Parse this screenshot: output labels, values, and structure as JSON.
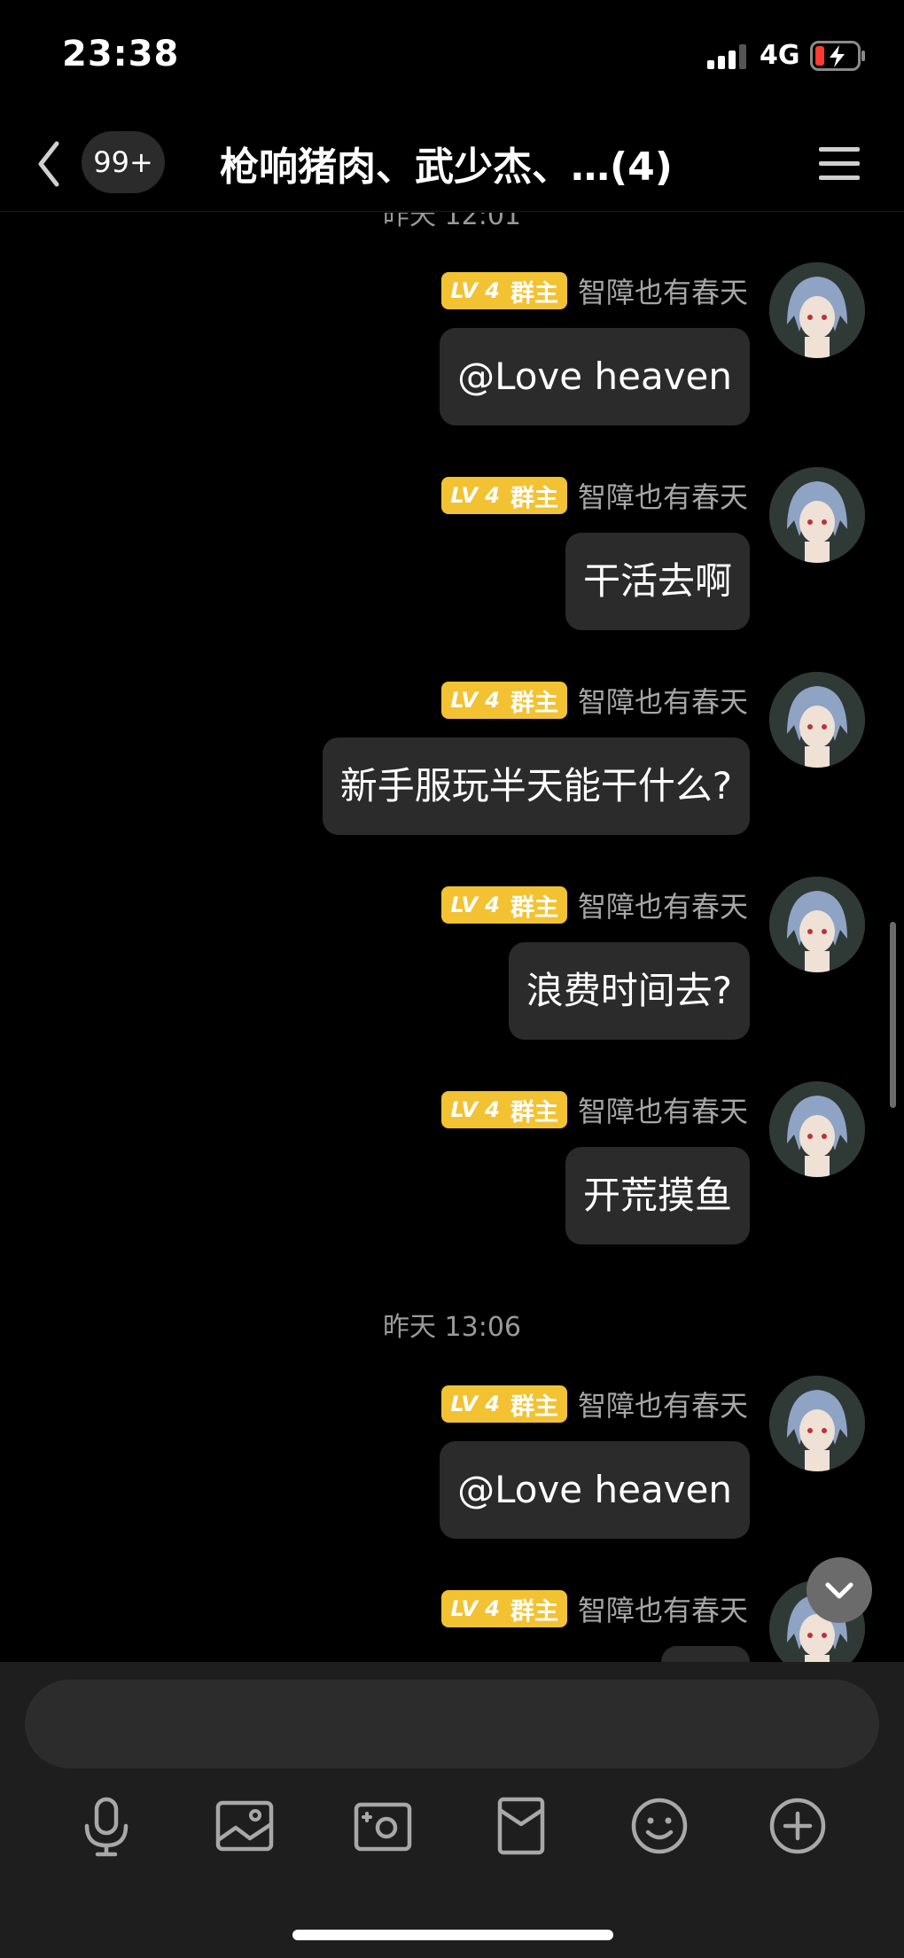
{
  "status_bar": {
    "time": "23:38",
    "network": "4G"
  },
  "header": {
    "back_icon": "chevron-left-icon",
    "unread_count": "99+",
    "title": "枪响猪肉、武少杰、…(4)",
    "menu_icon": "menu-icon"
  },
  "timestamps": [
    "昨天 12:01",
    "昨天 13:06"
  ],
  "messages": [
    {
      "level": "LV 4",
      "role": "群主",
      "sender": "智障也有春天",
      "text": "@Love heaven"
    },
    {
      "level": "LV 4",
      "role": "群主",
      "sender": "智障也有春天",
      "text": "干活去啊"
    },
    {
      "level": "LV 4",
      "role": "群主",
      "sender": "智障也有春天",
      "text": "新手服玩半天能干什么?"
    },
    {
      "level": "LV 4",
      "role": "群主",
      "sender": "智障也有春天",
      "text": "浪费时间去?"
    },
    {
      "level": "LV 4",
      "role": "群主",
      "sender": "智障也有春天",
      "text": "开荒摸鱼"
    },
    {
      "level": "LV 4",
      "role": "群主",
      "sender": "智障也有春天",
      "text": "@Love heaven"
    },
    {
      "level": "LV 4",
      "role": "群主",
      "sender": "智障也有春天",
      "text": ""
    }
  ],
  "input": {
    "placeholder": ""
  },
  "toolbar": [
    "microphone-icon",
    "image-icon",
    "camera-icon",
    "red-packet-icon",
    "emoji-icon",
    "plus-icon"
  ],
  "colors": {
    "background": "#000000",
    "bubble": "#2b2b2b",
    "badge": "#f2c233",
    "panel": "#1e1e1e"
  }
}
